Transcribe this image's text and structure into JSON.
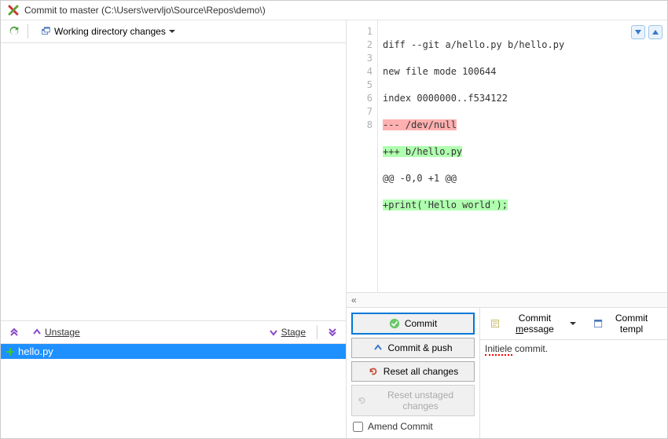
{
  "title": "Commit to master (C:\\Users\\vervljo\\Source\\Repos\\demo\\)",
  "toolbar": {
    "working_dir_label": "Working directory changes"
  },
  "stage_bar": {
    "unstage_label": "Unstage",
    "stage_label": "Stage"
  },
  "files": [
    {
      "name": "hello.py",
      "status": "added"
    }
  ],
  "diff": {
    "gutter": [
      "1",
      "2",
      "3",
      "4",
      "5",
      "6",
      "7",
      "8"
    ],
    "lines": [
      {
        "text": "diff --git a/hello.py b/hello.py",
        "type": "ctx"
      },
      {
        "text": "new file mode 100644",
        "type": "ctx"
      },
      {
        "text": "index 0000000..f534122",
        "type": "ctx"
      },
      {
        "text": "--- /dev/null",
        "type": "del"
      },
      {
        "text": "+++ b/hello.py",
        "type": "add"
      },
      {
        "text": "@@ -0,0 +1 @@",
        "type": "ctx"
      },
      {
        "text": "+print('Hello world');",
        "type": "add"
      },
      {
        "text": "",
        "type": "ctx"
      }
    ]
  },
  "collapse_char": "«",
  "commit_buttons": {
    "commit": "Commit",
    "commit_push": "Commit & push",
    "reset_all": "Reset all changes",
    "reset_unstaged": "Reset unstaged changes",
    "amend": "Amend Commit"
  },
  "message": {
    "dropdown_label": "Commit message",
    "template_label": "Commit templ",
    "text": "Initiele commit."
  }
}
